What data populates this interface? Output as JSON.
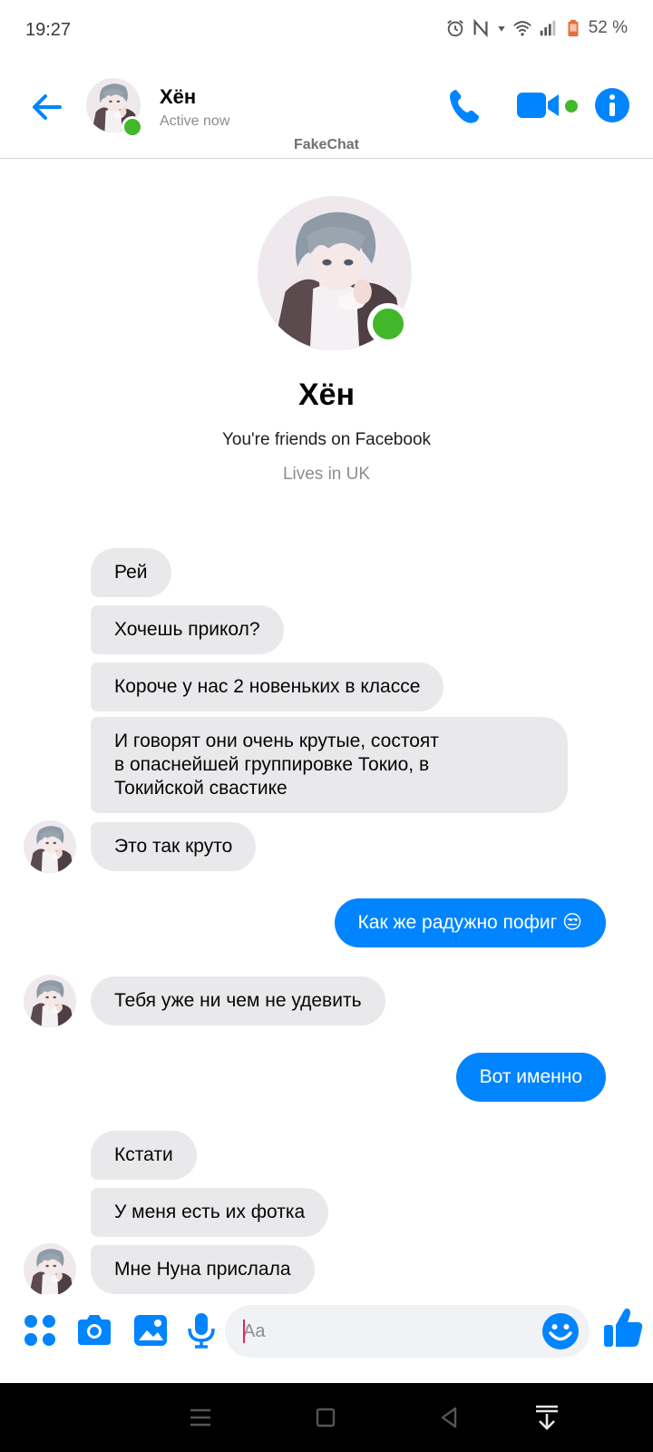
{
  "status_bar": {
    "time": "19:27",
    "battery": "52 %",
    "icons": [
      "alarm-icon",
      "nfc-icon",
      "wifi-icon",
      "signal-icon",
      "battery-icon"
    ]
  },
  "header": {
    "name": "Хён",
    "status": "Active now",
    "watermark": "FakeChat",
    "accent_color": "#0084ff",
    "presence_color": "#42b72a"
  },
  "profile": {
    "name": "Хён",
    "friends_text": "You're friends on Facebook",
    "location_text": "Lives in UK"
  },
  "messages": [
    {
      "from": "them",
      "text": "Рей"
    },
    {
      "from": "them",
      "text": "Хочешь прикол?"
    },
    {
      "from": "them",
      "text": "Короче у нас 2 новеньких в классе"
    },
    {
      "from": "them",
      "lines": [
        "И говорят они очень крутые, состоят",
        "в опаснейшей группировке Токио, в",
        "Токийской свастике"
      ]
    },
    {
      "from": "them",
      "text": "Это так круто"
    },
    {
      "from": "me",
      "text": "Как же радужно пофиг 😒"
    },
    {
      "from": "them",
      "text": "Тебя уже ни чем не удевить"
    },
    {
      "from": "me",
      "text": "Вот именно"
    },
    {
      "from": "them",
      "text": "Кстати"
    },
    {
      "from": "them",
      "text": "У меня есть их фотка"
    },
    {
      "from": "them",
      "text": "Мне Нуна прислала"
    }
  ],
  "composer": {
    "placeholder": "Aa",
    "icons": [
      "apps-icon",
      "camera-icon",
      "gallery-icon",
      "microphone-icon",
      "emoji-icon",
      "thumbs-up-icon"
    ]
  },
  "nav_bar": {
    "icons": [
      "menu-icon",
      "home-icon",
      "back-icon",
      "notification-pull-icon"
    ]
  }
}
